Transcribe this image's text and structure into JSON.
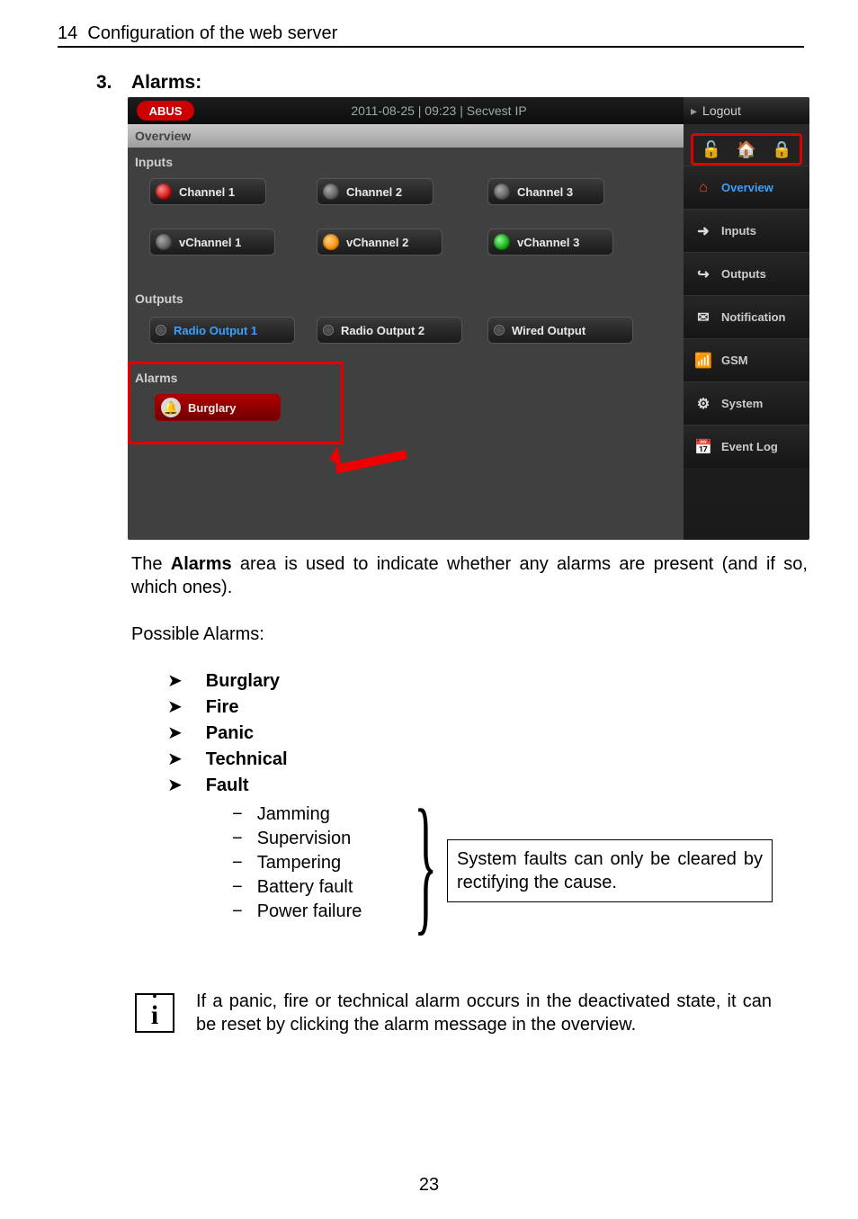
{
  "header": {
    "chapter_num": "14",
    "chapter_title": "Configuration of the web server"
  },
  "section": {
    "num": "3.",
    "title": "Alarms:"
  },
  "shot": {
    "brand": "ABUS",
    "topbar_mid": "2011-08-25  |  09:23  |  Secvest IP",
    "logout": "Logout",
    "overview_label": "Overview",
    "groups": {
      "inputs": "Inputs",
      "outputs": "Outputs",
      "alarms": "Alarms"
    },
    "channels": {
      "c1": "Channel 1",
      "c2": "Channel 2",
      "c3": "Channel 3",
      "v1": "vChannel 1",
      "v2": "vChannel 2",
      "v3": "vChannel 3"
    },
    "outputs": {
      "o1": "Radio Output 1",
      "o2": "Radio Output 2",
      "o3": "Wired Output"
    },
    "alarms": {
      "burglary": "Burglary"
    },
    "sidebar": {
      "overview": "Overview",
      "inputs": "Inputs",
      "outputs": "Outputs",
      "notification": "Notification",
      "gsm": "GSM",
      "system": "System",
      "eventlog": "Event Log"
    }
  },
  "body": {
    "para1a": "The ",
    "para1b": "Alarms",
    "para1c": " area is used to indicate whether any alarms are present (and if so, which ones).",
    "para2": "Possible Alarms:",
    "alarm_types": {
      "a1": "Burglary",
      "a2": "Fire",
      "a3": "Panic",
      "a4": "Technical",
      "a5": "Fault"
    },
    "faults": {
      "f1": "Jamming",
      "f2": "Supervision",
      "f3": "Tampering",
      "f4": "Battery fault",
      "f5": "Power failure"
    },
    "note_box": "System faults can only be cleared by rectifying the cause.",
    "info": "If a panic, fire or technical alarm occurs in the deactivated state, it can be reset by clicking the alarm message in the overview."
  },
  "page_num": "23"
}
